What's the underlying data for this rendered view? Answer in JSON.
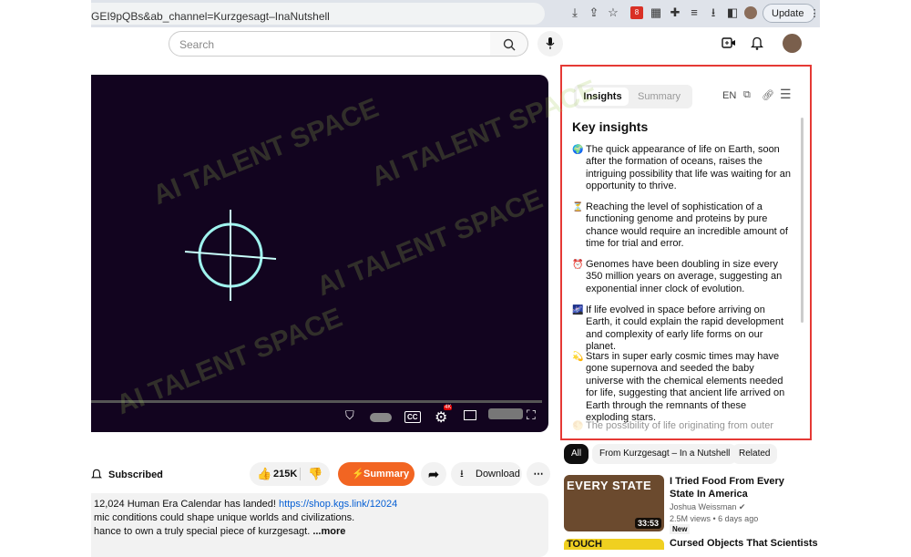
{
  "browser": {
    "url": "GEI9pQBs&ab_channel=Kurzgesagt–InaNutshell",
    "update_label": "Update",
    "badge_count": "8"
  },
  "header": {
    "search_placeholder": "Search"
  },
  "video": {
    "cc_label": "CC",
    "hd_label": "4K"
  },
  "actions": {
    "subscribed_label": "Subscribed",
    "likes": "215K",
    "summary_label": "Summary",
    "download_label": "Download"
  },
  "description": {
    "line1_prefix": "12,024 Human Era Calendar has landed!",
    "line1_link": "https://shop.kgs.link/12024",
    "line2": "mic conditions could shape unique worlds and civilizations.",
    "line3": "hance to own a truly special piece of kurzgesagt.",
    "more": "...more"
  },
  "panel": {
    "tab_insights": "Insights",
    "tab_summary": "Summary",
    "lang": "EN",
    "title": "Key insights",
    "insights": [
      {
        "emoji": "🌍",
        "text": "The quick appearance of life on Earth, soon after the formation of oceans, raises the intriguing possibility that life was waiting for an opportunity to thrive."
      },
      {
        "emoji": "⏳",
        "text": "Reaching the level of sophistication of a functioning genome and proteins by pure chance would require an incredible amount of time for trial and error."
      },
      {
        "emoji": "⏰",
        "text": "Genomes have been doubling in size every 350 million years on average, suggesting an exponential inner clock of evolution."
      },
      {
        "emoji": "🌌",
        "text": "If life evolved in space before arriving on Earth, it could explain the rapid development and complexity of early life forms on our planet."
      },
      {
        "emoji": "💫",
        "text": "Stars in super early cosmic times may have gone supernova and seeded the baby universe with the chemical elements needed for life, suggesting that ancient life arrived on Earth through the remnants of these exploding stars."
      },
      {
        "emoji": "🌕",
        "text": "The possibility of life originating from outer"
      }
    ]
  },
  "related": {
    "chips": [
      "All",
      "From Kurzgesagt – In a Nutshell",
      "Related"
    ],
    "videos": [
      {
        "title": "I Tried Food From Every State In America",
        "channel": "Joshua Weissman",
        "meta": "2.5M views • 6 days ago",
        "badge": "New",
        "duration": "33:53",
        "thumb_text": "EVERY STATE"
      },
      {
        "title": "Cursed Objects That Scientists",
        "thumb_text": "TOUCH"
      }
    ]
  },
  "watermark": "AI TALENT SPACE"
}
